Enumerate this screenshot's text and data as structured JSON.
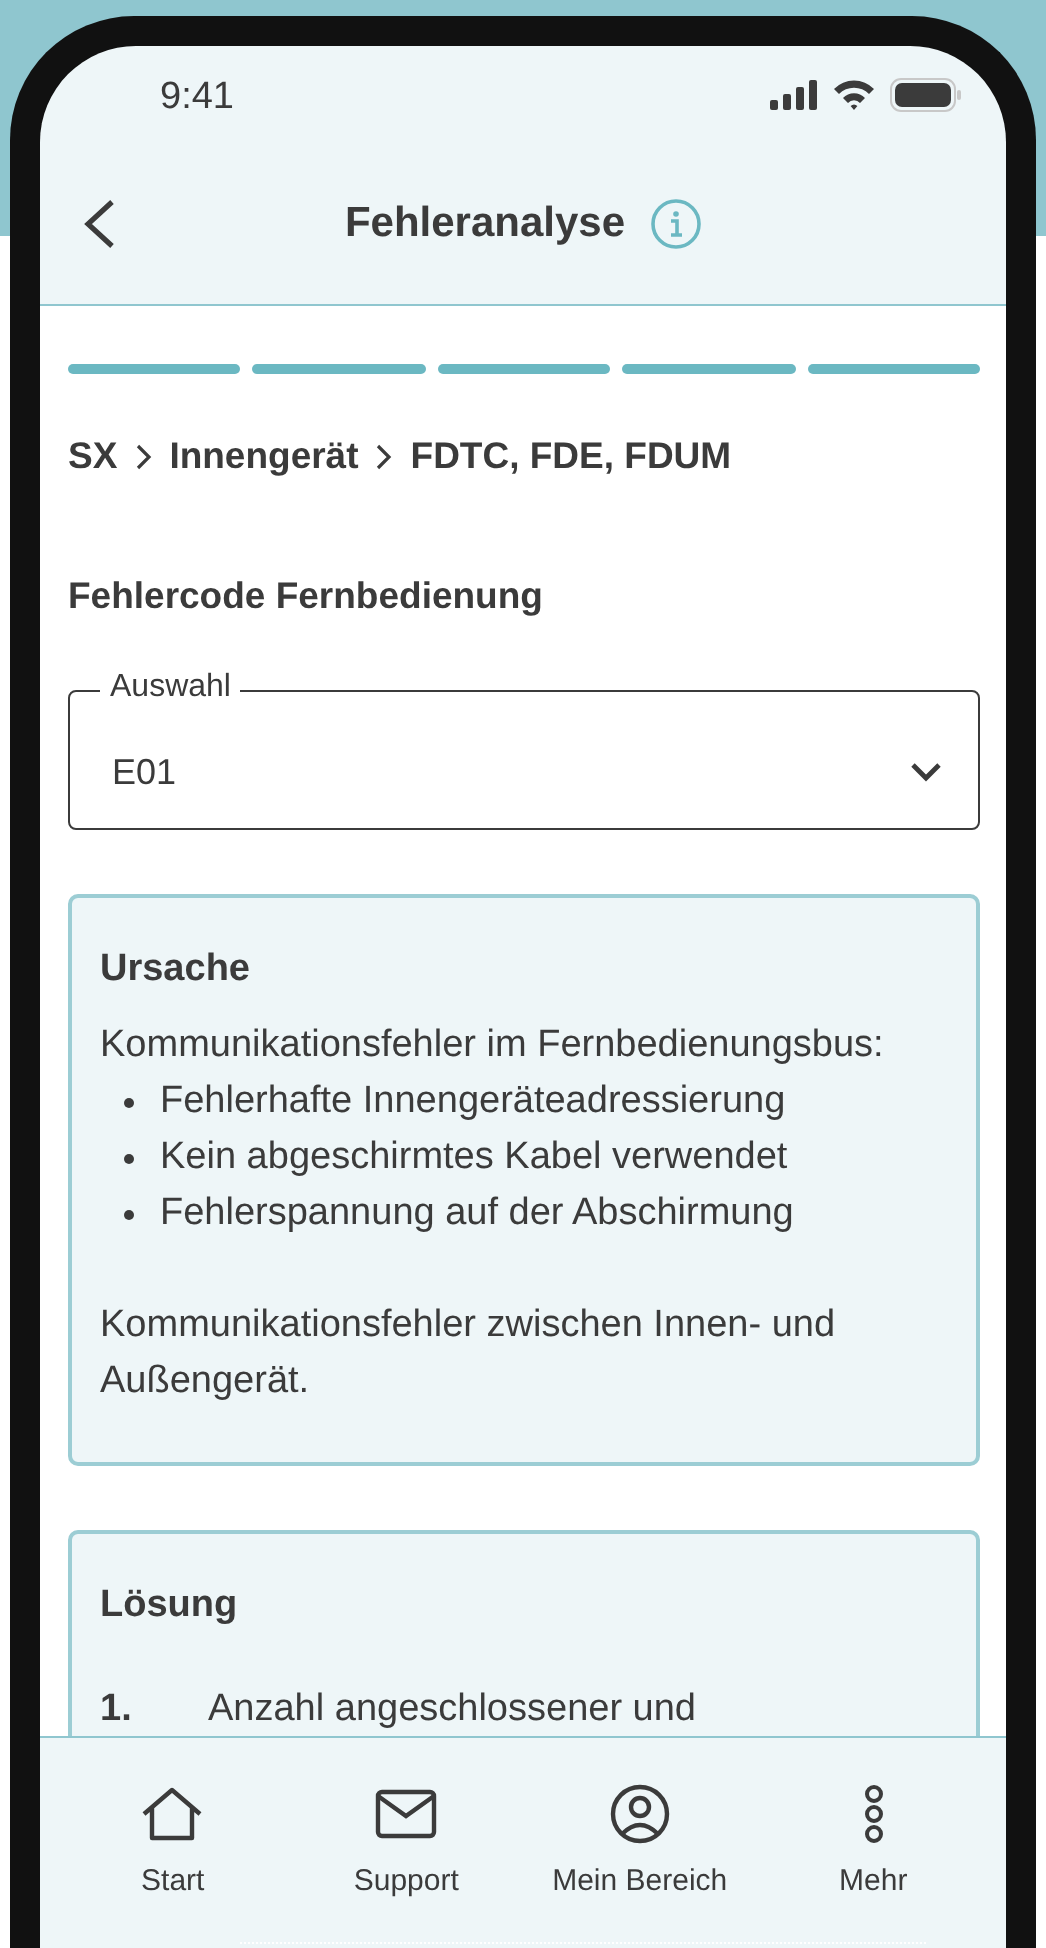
{
  "status_bar": {
    "time": "9:41"
  },
  "header": {
    "title": "Fehleranalyse"
  },
  "progress": [
    {
      "done": true
    },
    {
      "done": true
    },
    {
      "done": true
    },
    {
      "done": true
    },
    {
      "done": true
    }
  ],
  "breadcrumb": [
    "SX",
    "Innengerät",
    "FDTC, FDE, FDUM"
  ],
  "section_title": "Fehlercode Fernbedienung",
  "select": {
    "label": "Auswahl",
    "value": "E01"
  },
  "cards": [
    {
      "title": "Ursache",
      "blocks": [
        {
          "kind": "paragraph",
          "text": "Kommunikationsfehler im Fernbedienungsbus:"
        },
        {
          "kind": "bullets",
          "items": [
            "Fehlerhafte Innengeräteadressierung",
            "Kein abgeschirmtes Kabel verwendet",
            "Fehlerspannung auf der Abschirmung"
          ]
        },
        {
          "kind": "paragraph",
          "text": "Kommunikationsfehler zwischen Innen- und Außengerät."
        }
      ]
    },
    {
      "title": "Lösung",
      "blocks": [
        {
          "kind": "steps",
          "items": [
            {
              "number": "1.",
              "text": "Anzahl angeschlossener und"
            }
          ]
        }
      ]
    }
  ],
  "bottom_nav": [
    {
      "kind": "home",
      "label": "Start"
    },
    {
      "kind": "mail",
      "label": "Support"
    },
    {
      "kind": "user",
      "label": "Mein Bereich"
    },
    {
      "kind": "more",
      "label": "Mehr"
    }
  ]
}
